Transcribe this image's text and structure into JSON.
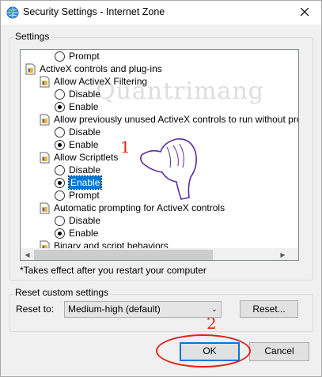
{
  "window": {
    "title": "Security Settings - Internet Zone",
    "title_icon": "globe-icon",
    "close_icon": "close-icon"
  },
  "settings_group": {
    "label": "Settings",
    "items": [
      {
        "kind": "radio",
        "label": "Prompt",
        "checked": false
      },
      {
        "kind": "category",
        "label": "ActiveX controls and plug-ins"
      },
      {
        "kind": "setting",
        "label": "Allow ActiveX Filtering"
      },
      {
        "kind": "radio",
        "label": "Disable",
        "checked": false
      },
      {
        "kind": "radio",
        "label": "Enable",
        "checked": true
      },
      {
        "kind": "setting",
        "label": "Allow previously unused ActiveX controls to run without prom"
      },
      {
        "kind": "radio",
        "label": "Disable",
        "checked": false
      },
      {
        "kind": "radio",
        "label": "Enable",
        "checked": true
      },
      {
        "kind": "setting",
        "label": "Allow Scriptlets"
      },
      {
        "kind": "radio",
        "label": "Disable",
        "checked": false
      },
      {
        "kind": "radio",
        "label": "Enable",
        "checked": true,
        "selected": true
      },
      {
        "kind": "radio",
        "label": "Prompt",
        "checked": false
      },
      {
        "kind": "setting",
        "label": "Automatic prompting for ActiveX controls"
      },
      {
        "kind": "radio",
        "label": "Disable",
        "checked": false
      },
      {
        "kind": "radio",
        "label": "Enable",
        "checked": true
      },
      {
        "kind": "setting",
        "label": "Binary and script behaviors"
      }
    ],
    "note": "*Takes effect after you restart your computer"
  },
  "reset_group": {
    "label": "Reset custom settings",
    "reset_to_label": "Reset to:",
    "selected_level": "Medium-high (default)",
    "reset_button": "Reset..."
  },
  "buttons": {
    "ok": "OK",
    "cancel": "Cancel"
  },
  "annotations": {
    "step1": "1",
    "step2": "2",
    "color": "#e2231a",
    "watermark": "Quantrimang"
  },
  "colors": {
    "selection": "#0078d7",
    "window_bg": "#f0f0f0"
  }
}
